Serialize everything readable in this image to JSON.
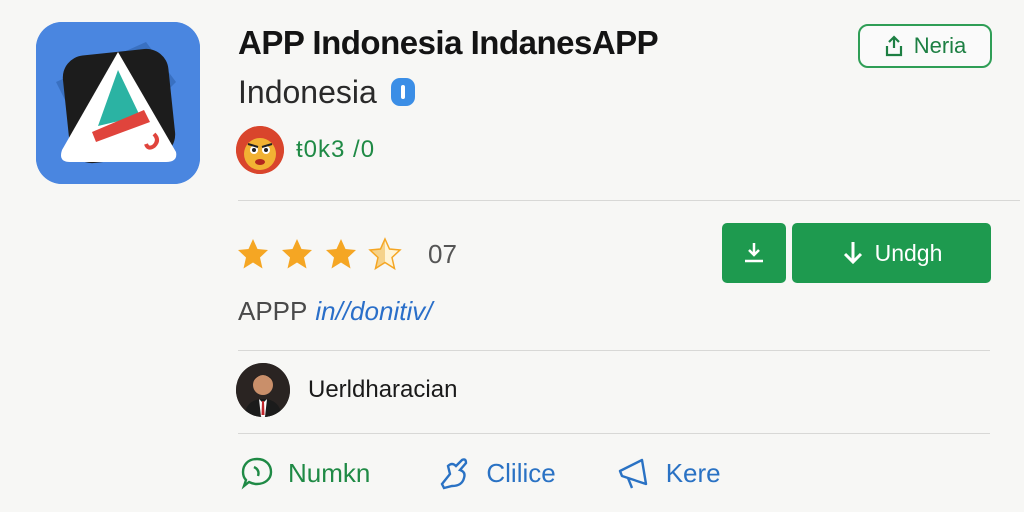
{
  "app": {
    "title": "APP Indonesia IndanesAPP",
    "subtitle": "Indonesia",
    "stat": "ŧ0k3 /0"
  },
  "share_button": {
    "label": "Neria"
  },
  "rating": {
    "stars": 3.5,
    "max": 5,
    "count": "07"
  },
  "download_button": {
    "label": "Undgh"
  },
  "category": {
    "prefix": "APPP",
    "link": "in//donitiv/"
  },
  "developer": {
    "name": "Uerldharacian"
  },
  "actions": [
    {
      "label": "Numkn",
      "icon": "chat-bubble-icon"
    },
    {
      "label": "Clilice",
      "icon": "hand-wave-icon"
    },
    {
      "label": "Kere",
      "icon": "megaphone-icon"
    }
  ],
  "colors": {
    "accent_green": "#1e9a4f",
    "link_blue": "#2a72c4",
    "icon_blue": "#4a86e0",
    "star": "#f5a623"
  }
}
